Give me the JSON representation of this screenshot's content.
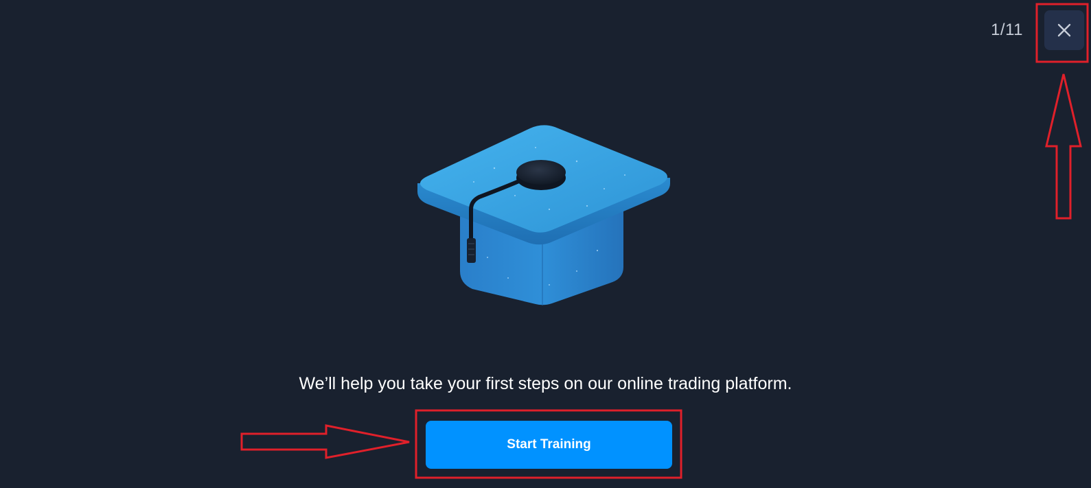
{
  "header": {
    "step_counter": "1/11",
    "close_icon": "close-icon"
  },
  "hero": {
    "icon": "graduation-cap-icon"
  },
  "main": {
    "message": "We’ll help you take your first steps on our online trading platform.",
    "start_button_label": "Start Training"
  },
  "colors": {
    "background": "#19212f",
    "accent": "#0192ff",
    "close_button_bg": "#24304a",
    "annotation": "#e0202a"
  }
}
